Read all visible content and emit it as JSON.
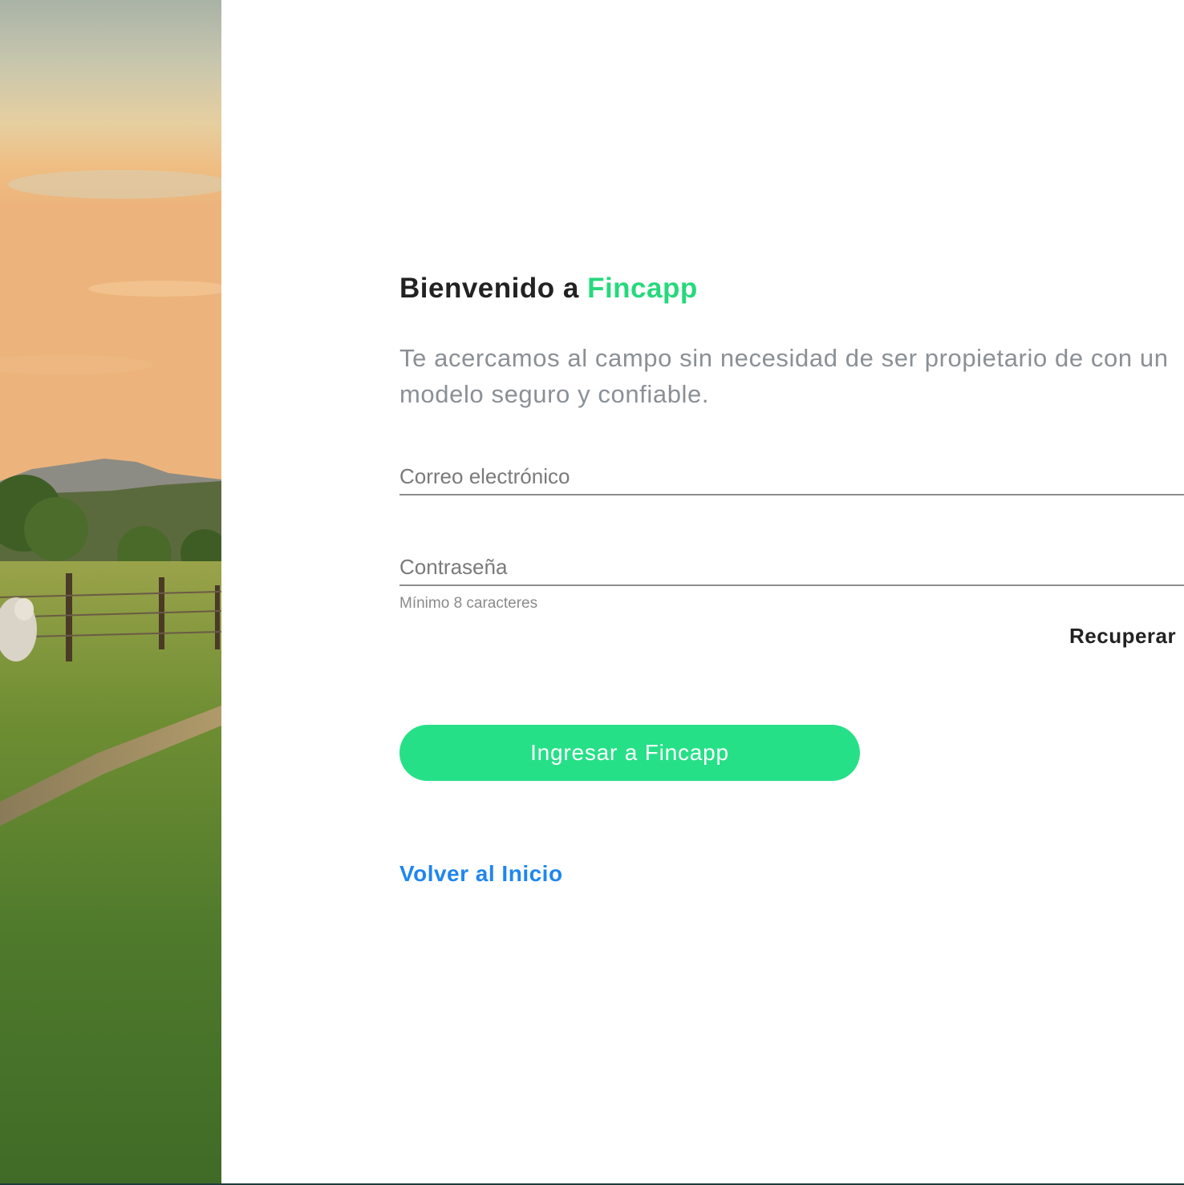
{
  "heading": {
    "prefix": "Bienvenido a",
    "brand": "Fincapp"
  },
  "subtitle": "Te acercamos al campo sin necesidad de ser propietario de con un modelo seguro y confiable.",
  "form": {
    "email_placeholder": "Correo electrónico",
    "password_placeholder": "Contraseña",
    "password_hint": "Mínimo 8 caracteres",
    "recover_label": "Recuperar",
    "submit_label": "Ingresar a Fincapp"
  },
  "back_link_label": "Volver al Inicio",
  "colors": {
    "brand_green": "#26d97c",
    "button_green": "#26e087",
    "link_blue": "#1f86ef"
  }
}
